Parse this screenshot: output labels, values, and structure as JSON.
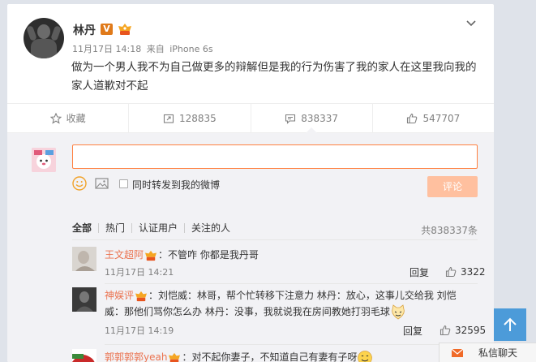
{
  "post": {
    "username": "林丹",
    "verified_mark": "V",
    "time": "11月17日 14:18",
    "source_prefix": "来自",
    "source": "iPhone 6s",
    "text": "做为一个男人我不为自己做更多的辩解但是我的行为伤害了我的家人在这里我向我的家人道歉对不起"
  },
  "actions": {
    "favorite": "收藏",
    "repost": "128835",
    "comment": "838337",
    "like": "547707"
  },
  "composer": {
    "input_value": "",
    "repost_checkbox_label": "同时转发到我的微博",
    "submit_label": "评论"
  },
  "filters": {
    "all": "全部",
    "hot": "热门",
    "verified": "认证用户",
    "following": "关注的人",
    "total": "共838337条"
  },
  "comments": [
    {
      "name": "王文超阿",
      "text": "：不管咋 你都是我丹哥",
      "time": "11月17日 14:21",
      "reply": "回复",
      "likes": "3322"
    },
    {
      "name": "神娱评",
      "text_line1": "：刘恺威：林哥，帮个忙转移下注意力 林丹：放心，这事儿交给我 刘恺",
      "text_line2": "威：那他们骂你怎么办 林丹：没事，我就说我在房间教她打羽毛球",
      "time": "11月17日 14:19",
      "reply": "回复",
      "likes": "32595"
    },
    {
      "name": "郭郭郭郭yeah",
      "text": "：对不起你妻子，不知道自己有妻有子呀"
    }
  ],
  "chat": {
    "label": "私信聊天"
  },
  "colors": {
    "accent": "#ff8140",
    "link": "#eb7350",
    "scroll_button": "#4c9bd9"
  }
}
